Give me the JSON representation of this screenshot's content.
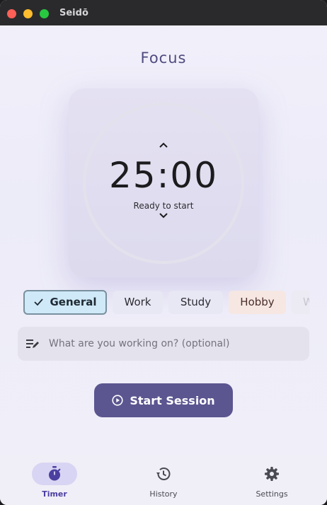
{
  "window": {
    "title": "Seidō"
  },
  "page": {
    "title": "Focus"
  },
  "timer": {
    "minutes": "25",
    "separator": ":",
    "seconds": "00",
    "status": "Ready to start"
  },
  "categories": [
    {
      "label": "General",
      "selected": true
    },
    {
      "label": "Work",
      "selected": false
    },
    {
      "label": "Study",
      "selected": false
    },
    {
      "label": "Hobby",
      "selected": false
    },
    {
      "label": "W",
      "selected": false
    }
  ],
  "note": {
    "placeholder": "What are you working on? (optional)",
    "value": ""
  },
  "start_button": {
    "label": "Start Session"
  },
  "nav": [
    {
      "label": "Timer",
      "icon": "stopwatch-icon",
      "active": true
    },
    {
      "label": "History",
      "icon": "history-icon",
      "active": false
    },
    {
      "label": "Settings",
      "icon": "gear-icon",
      "active": false
    }
  ],
  "colors": {
    "accent": "#5b5690",
    "selected_chip": "#cfe9f8",
    "hobby_chip": "#f6e7e3",
    "nav_active": "#4b3fa0"
  }
}
